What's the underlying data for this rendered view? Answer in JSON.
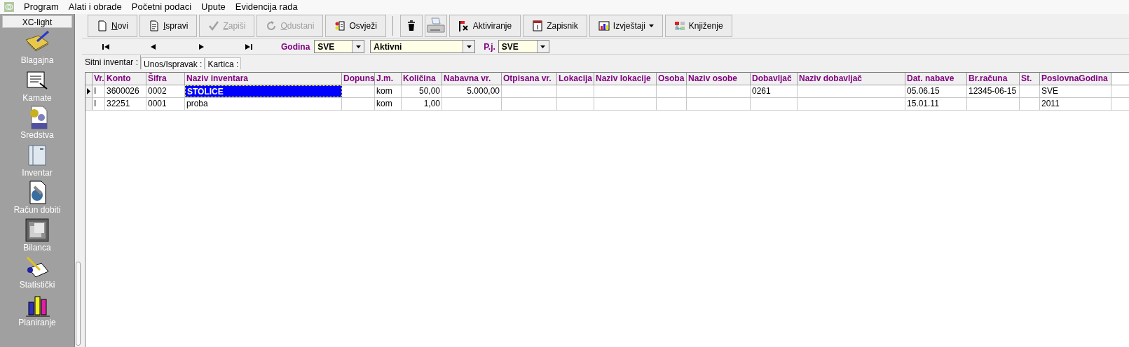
{
  "menu": [
    "Program",
    "Alati i obrade",
    "Početni podaci",
    "Upute",
    "Evidencija rada"
  ],
  "sidebar": {
    "title": "XC-light",
    "items": [
      {
        "label": "Blagajna",
        "kind": "ledger"
      },
      {
        "label": "Kamate",
        "kind": "scroll"
      },
      {
        "label": "Sredstva",
        "kind": "gears"
      },
      {
        "label": "Inventar",
        "kind": "cabinet"
      },
      {
        "label": "Račun dobiti",
        "kind": "document"
      },
      {
        "label": "Bilanca",
        "kind": "frames"
      },
      {
        "label": "Statistički",
        "kind": "notepad"
      },
      {
        "label": "Planiranje",
        "kind": "bars"
      }
    ]
  },
  "toolbar": [
    {
      "kind": "new",
      "label": "Novi",
      "disabled": false,
      "mnemonic": true
    },
    {
      "kind": "edit",
      "label": "Ispravi",
      "disabled": false,
      "mnemonic": true
    },
    {
      "kind": "save",
      "label": "Zapiši",
      "disabled": true,
      "mnemonic": true
    },
    {
      "kind": "cancel",
      "label": "Odustani",
      "disabled": true,
      "mnemonic": true
    },
    {
      "kind": "refresh",
      "label": "Osvježi",
      "disabled": false,
      "mnemonic": false
    },
    {
      "kind": "trash",
      "disabled": false
    },
    {
      "kind": "printer",
      "disabled": false
    },
    {
      "kind": "activate",
      "label": "Aktiviranje",
      "disabled": false,
      "mnemonic": false
    },
    {
      "kind": "calendar",
      "label": "Zapisnik",
      "disabled": false,
      "mnemonic": false
    },
    {
      "kind": "reports",
      "label": "Izvještaji",
      "disabled": false,
      "mnemonic": false,
      "dropdown": true
    },
    {
      "kind": "booking",
      "label": "Knjiženje",
      "disabled": false,
      "mnemonic": false
    }
  ],
  "filters": {
    "year_label": "Godina",
    "year": "SVE",
    "status": "Aktivni",
    "unit_label": "P.j.",
    "unit": "SVE"
  },
  "tabs": [
    {
      "label": "Sitni inventar :",
      "selected": true
    },
    {
      "label": "Unos/Ispravak :",
      "selected": false
    },
    {
      "label": "Kartica :",
      "selected": false
    }
  ],
  "table": {
    "columns": [
      {
        "label": "Vr.",
        "kind": "text",
        "focused": false
      },
      {
        "label": "Konto",
        "kind": "text",
        "focused": false
      },
      {
        "label": "Šifra",
        "kind": "text",
        "focused": false
      },
      {
        "label": "Naziv inventara",
        "kind": "text",
        "focused": true
      },
      {
        "label": "Dopuns",
        "kind": "text",
        "focused": false
      },
      {
        "label": "J.m.",
        "kind": "text",
        "focused": false
      },
      {
        "label": "Količina",
        "kind": "number",
        "focused": false
      },
      {
        "label": "Nabavna vr.",
        "kind": "number",
        "focused": false
      },
      {
        "label": "Otpisana vr.",
        "kind": "number",
        "focused": false
      },
      {
        "label": "Lokacija",
        "kind": "text",
        "focused": false
      },
      {
        "label": "Naziv lokacije",
        "kind": "text",
        "focused": false
      },
      {
        "label": "Osoba",
        "kind": "text",
        "focused": false
      },
      {
        "label": "Naziv osobe",
        "kind": "text",
        "focused": false
      },
      {
        "label": "Dobavljač",
        "kind": "text",
        "focused": false
      },
      {
        "label": "Naziv dobavljač",
        "kind": "text",
        "focused": false
      },
      {
        "label": "Dat. nabave",
        "kind": "text",
        "focused": false
      },
      {
        "label": "Br.računa",
        "kind": "text",
        "focused": false
      },
      {
        "label": "St.",
        "kind": "text",
        "focused": false
      },
      {
        "label": "PoslovnaGodina",
        "kind": "text",
        "focused": false
      }
    ],
    "rows": [
      {
        "selected": true,
        "cells": [
          "I",
          "3600026",
          "0002",
          "STOLICE",
          "",
          "kom",
          "50,00",
          "5.000,00",
          "",
          "",
          "",
          "",
          "",
          "0261",
          "",
          "05.06.15",
          "12345-06-15",
          "",
          "SVE"
        ]
      },
      {
        "selected": false,
        "cells": [
          "I",
          "32251",
          "0001",
          "proba",
          "",
          "kom",
          "1,00",
          "",
          "",
          "",
          "",
          "",
          "",
          "",
          "",
          "15.01.11",
          "",
          "",
          "2011"
        ]
      }
    ]
  }
}
